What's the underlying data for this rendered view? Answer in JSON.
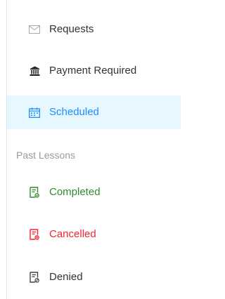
{
  "menu": {
    "requests": {
      "label": "Requests",
      "icon": "mail-icon"
    },
    "payment_required": {
      "label": "Payment Required",
      "icon": "bank-icon"
    },
    "scheduled": {
      "label": "Scheduled",
      "icon": "calendar-icon"
    },
    "past_lessons_heading": "Past Lessons",
    "completed": {
      "label": "Completed",
      "icon": "document-check-icon"
    },
    "cancelled": {
      "label": "Cancelled",
      "icon": "document-cancel-icon"
    },
    "denied": {
      "label": "Denied",
      "icon": "document-deny-icon"
    }
  },
  "colors": {
    "default_text": "#333333",
    "active_text": "#1890ff",
    "active_bg": "#e6f7ff",
    "section_text": "#9a9a9a",
    "completed": "#2e8b2e",
    "cancelled": "#f5222d",
    "denied": "#444444"
  }
}
